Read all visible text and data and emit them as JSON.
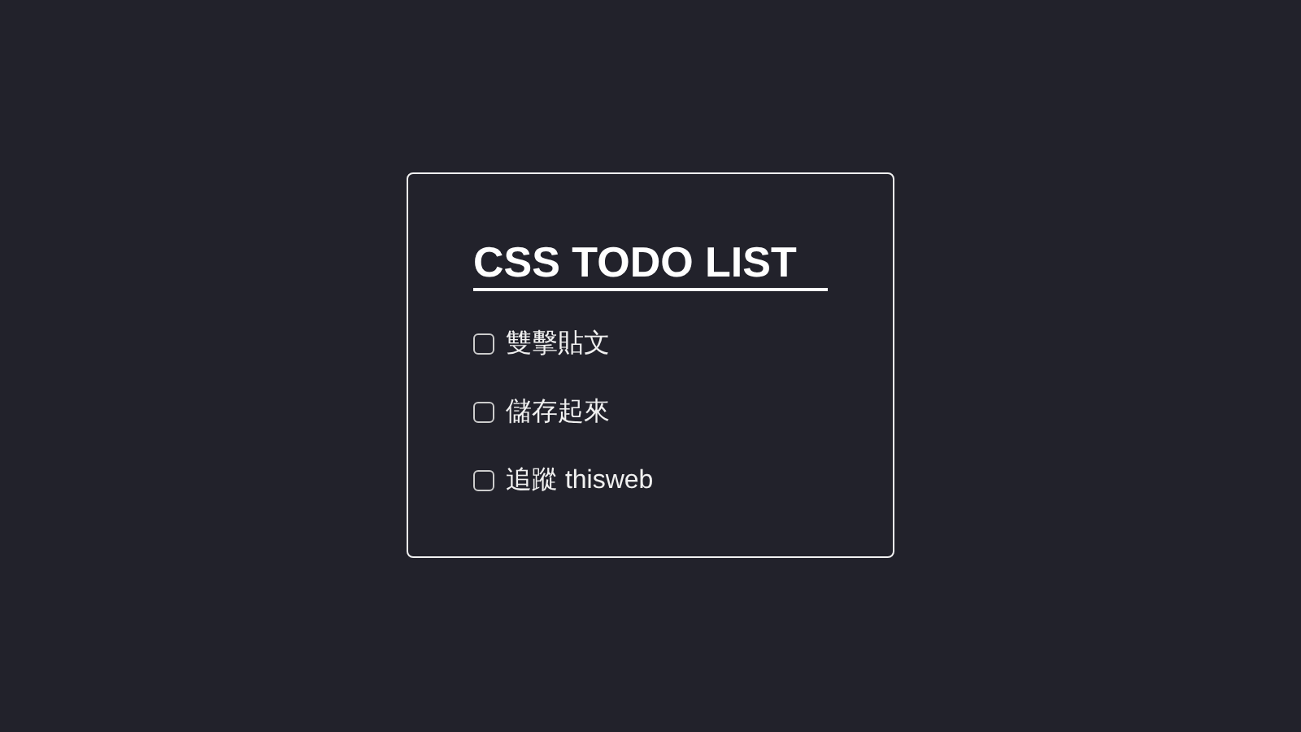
{
  "card": {
    "title": "CSS TODO LIST",
    "items": [
      {
        "label": "雙擊貼文",
        "checked": false
      },
      {
        "label": "儲存起來",
        "checked": false
      },
      {
        "label": "追蹤 thisweb",
        "checked": false
      }
    ]
  }
}
